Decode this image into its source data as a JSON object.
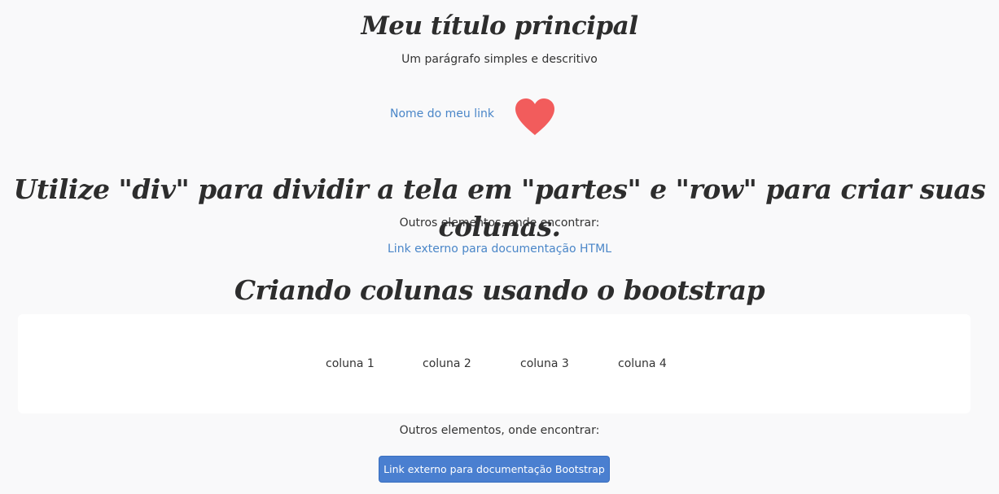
{
  "header": {
    "title": "Meu título principal",
    "subtitle": "Um parágrafo simples e descritivo"
  },
  "link_row": {
    "link_text": "Nome do meu link",
    "heart_icon": "heart-icon",
    "heart_color": "#f25c5c"
  },
  "section": {
    "title": "Utilize \"div\" para dividir a tela em \"partes\" e \"row\" para criar suas colunas.",
    "other_elements": "Outros elementos, onde encontrar:",
    "html_doc_link": "Link externo para documentação HTML"
  },
  "bootstrap": {
    "title": "Criando colunas usando o bootstrap",
    "columns": [
      "coluna 1",
      "coluna 2",
      "coluna 3",
      "coluna 4"
    ],
    "other_elements": "Outros elementos, onde encontrar:",
    "button_label": "Link externo para documentação Bootstrap"
  },
  "colors": {
    "link": "#4a86c8",
    "button": "#4a7fd0",
    "background": "#f9f9fa"
  }
}
